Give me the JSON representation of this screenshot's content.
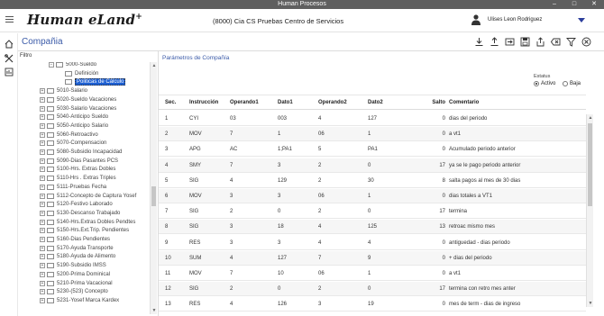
{
  "window": {
    "title": "Human Procesos"
  },
  "header": {
    "logo": "Human eLand",
    "logo_mark": "+",
    "company": "(8000) Cia  CS  Pruebas Centro de Servicios",
    "user_name": "Ulises Leon Rodriguez"
  },
  "page": {
    "title": "Compañia"
  },
  "toolbar": {
    "icons": [
      "download-icon",
      "upload-icon",
      "export-icon",
      "save-icon",
      "share-icon",
      "delete-icon",
      "filter-icon",
      "close-icon"
    ]
  },
  "left_panel": {
    "filter_label": "Filtro",
    "tree": [
      {
        "label": "5000-Sueldo",
        "level": 1,
        "expanded": true,
        "selected": false
      },
      {
        "label": "Definición",
        "level": 2,
        "expanded": false,
        "selected": false
      },
      {
        "label": "Politicas de Cálculo",
        "level": 2,
        "expanded": false,
        "selected": true
      },
      {
        "label": "5010-Salario",
        "level": 0,
        "expanded": false,
        "selected": false
      },
      {
        "label": "5020-Sueldo Vacaciones",
        "level": 0,
        "expanded": false,
        "selected": false
      },
      {
        "label": "5030-Salario Vacaciones",
        "level": 0,
        "expanded": false,
        "selected": false
      },
      {
        "label": "5040-Anticipo Sueldo",
        "level": 0,
        "expanded": false,
        "selected": false
      },
      {
        "label": "5050-Anticipo Salario",
        "level": 0,
        "expanded": false,
        "selected": false
      },
      {
        "label": "5060-Retroactivo",
        "level": 0,
        "expanded": false,
        "selected": false
      },
      {
        "label": "5070-Compensacion",
        "level": 0,
        "expanded": false,
        "selected": false
      },
      {
        "label": "5080-Subsidio Incapacidad",
        "level": 0,
        "expanded": false,
        "selected": false
      },
      {
        "label": "5090-Dias Pasantes PCS",
        "level": 0,
        "expanded": false,
        "selected": false
      },
      {
        "label": "5100-Hrs. Extras Dobles",
        "level": 0,
        "expanded": false,
        "selected": false
      },
      {
        "label": "5110-Hrs . Extras Triples",
        "level": 0,
        "expanded": false,
        "selected": false
      },
      {
        "label": "5111-Pruebas Fecha",
        "level": 0,
        "expanded": false,
        "selected": false
      },
      {
        "label": "5112-Concepto de Captura Yosef",
        "level": 0,
        "expanded": false,
        "selected": false
      },
      {
        "label": "5120-Festivo Laborado",
        "level": 0,
        "expanded": false,
        "selected": false
      },
      {
        "label": "5130-Descanso Trabajado",
        "level": 0,
        "expanded": false,
        "selected": false
      },
      {
        "label": "5140-Hrs.Extras Dobles Pendtes",
        "level": 0,
        "expanded": false,
        "selected": false
      },
      {
        "label": "5150-Hrs.Ext.Trip. Pendientes",
        "level": 0,
        "expanded": false,
        "selected": false
      },
      {
        "label": "5160-Dias Pendientes",
        "level": 0,
        "expanded": false,
        "selected": false
      },
      {
        "label": "5170-Ayuda Transporte",
        "level": 0,
        "expanded": false,
        "selected": false
      },
      {
        "label": "5180-Ayuda de Alimento",
        "level": 0,
        "expanded": false,
        "selected": false
      },
      {
        "label": "5190-Subsidio IMSS",
        "level": 0,
        "expanded": false,
        "selected": false
      },
      {
        "label": "5200-Prima Dominical",
        "level": 0,
        "expanded": false,
        "selected": false
      },
      {
        "label": "5210-Prima Vacacional",
        "level": 0,
        "expanded": false,
        "selected": false
      },
      {
        "label": "5230-(523) Concepto",
        "level": 0,
        "expanded": false,
        "selected": false
      },
      {
        "label": "5231-Yosef Marca Kardex",
        "level": 0,
        "expanded": false,
        "selected": false
      }
    ]
  },
  "content": {
    "section_title": "Parámetros de Compañía",
    "estatus": {
      "label": "Estatus",
      "options": [
        {
          "label": "Activo",
          "checked": true
        },
        {
          "label": "Baja",
          "checked": false
        }
      ]
    },
    "table": {
      "columns": [
        "Sec.",
        "Instrucción",
        "Operando1",
        "Dato1",
        "Operando2",
        "Dato2",
        "Salto",
        "Comentario"
      ],
      "rows": [
        [
          "1",
          "CYI",
          "03",
          "003",
          "4",
          "127",
          "0",
          "dias del periodo"
        ],
        [
          "2",
          "MOV",
          "7",
          "1",
          "06",
          "1",
          "0",
          "a vt1"
        ],
        [
          "3",
          "APG",
          "AC",
          "1;PA1",
          "5",
          "PA1",
          "0",
          "Acumulado periodo anterior"
        ],
        [
          "4",
          "SMY",
          "7",
          "3",
          "2",
          "0",
          "17",
          "ya se le pago periodo anterior"
        ],
        [
          "5",
          "SIG",
          "4",
          "129",
          "2",
          "30",
          "8",
          "salta pagos al mes de 30 dias"
        ],
        [
          "6",
          "MOV",
          "3",
          "3",
          "06",
          "1",
          "0",
          "dias totales a VT1"
        ],
        [
          "7",
          "SIG",
          "2",
          "0",
          "2",
          "0",
          "17",
          "termina"
        ],
        [
          "8",
          "SIG",
          "3",
          "18",
          "4",
          "125",
          "13",
          "retroac mismo mes"
        ],
        [
          "9",
          "RES",
          "3",
          "3",
          "4",
          "4",
          "0",
          "antiguedad - dias periodo"
        ],
        [
          "10",
          "SUM",
          "4",
          "127",
          "7",
          "9",
          "0",
          "+ dias del periodo"
        ],
        [
          "11",
          "MOV",
          "7",
          "10",
          "06",
          "1",
          "0",
          "a vt1"
        ],
        [
          "12",
          "SIG",
          "2",
          "0",
          "2",
          "0",
          "17",
          "termina  con retro mes anter"
        ],
        [
          "13",
          "RES",
          "4",
          "126",
          "3",
          "19",
          "0",
          "mes de term - dias de ingreso"
        ]
      ]
    }
  },
  "colors": {
    "accent": "#3a5aa8",
    "selection": "#1e60d3",
    "titlebar": "#5f5f5f"
  }
}
